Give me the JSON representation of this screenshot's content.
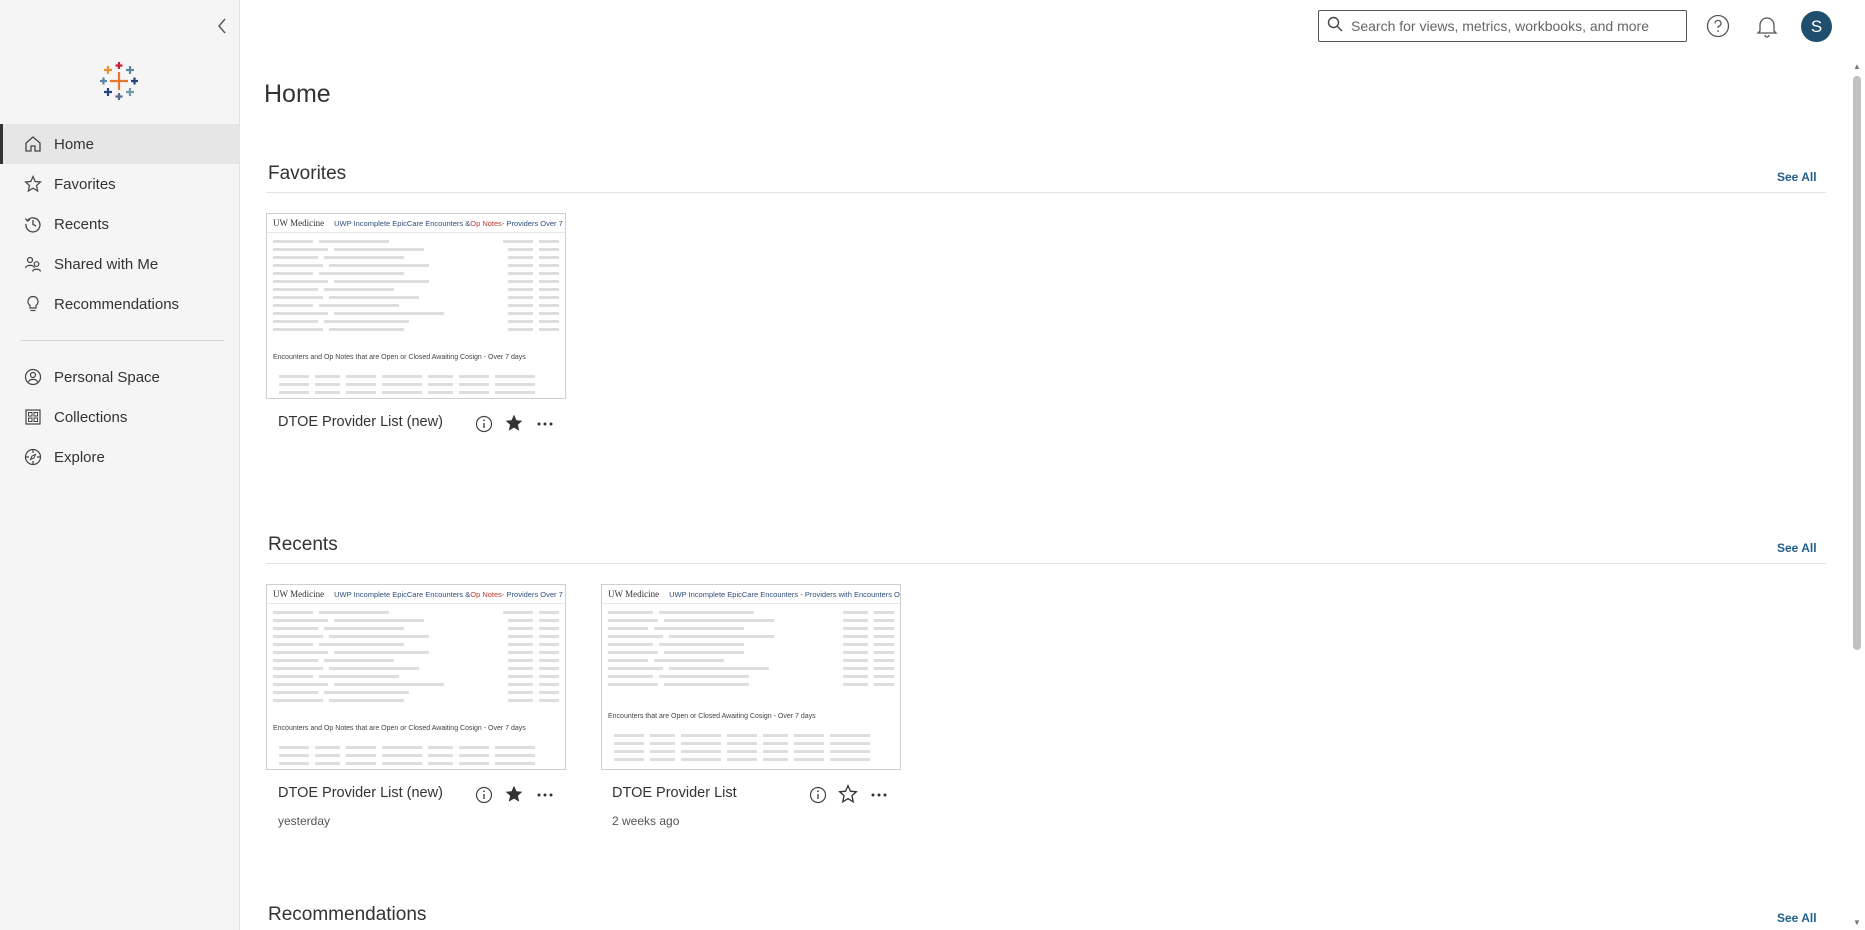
{
  "sidebar": {
    "collapse_icon": "chevron-left-icon",
    "items": [
      {
        "label": "Home",
        "icon": "home-icon"
      },
      {
        "label": "Favorites",
        "icon": "star-icon"
      },
      {
        "label": "Recents",
        "icon": "recents-icon"
      },
      {
        "label": "Shared with Me",
        "icon": "shared-icon"
      },
      {
        "label": "Recommendations",
        "icon": "lightbulb-icon"
      },
      {
        "label": "Personal Space",
        "icon": "person-icon"
      },
      {
        "label": "Collections",
        "icon": "collections-icon"
      },
      {
        "label": "Explore",
        "icon": "explore-icon"
      }
    ]
  },
  "topbar": {
    "search_placeholder": "Search for views, metrics, workbooks, and more",
    "avatar_initial": "S"
  },
  "main": {
    "title": "Home",
    "sections": {
      "favorites": {
        "title": "Favorites",
        "see_all": "See All"
      },
      "recents": {
        "title": "Recents",
        "see_all": "See All"
      },
      "recommendations": {
        "title": "Recommendations",
        "see_all": "See All"
      }
    }
  },
  "thumbnails": {
    "brand": "UW Medicine",
    "title_a": "UWP Incomplete EpicCare Encounters & ",
    "title_a_red": "Op Notes",
    "title_a_rest": " - Providers Over 7",
    "title_b": "UWP Incomplete EpicCare Encounters - Providers with Encounters Ove",
    "footer_a": "Encounters and Op Notes that are Open or Closed Awaiting Cosign - Over 7 days",
    "footer_b": "Encounters that are Open or Closed Awaiting Cosign - Over 7 days"
  },
  "cards": {
    "fav1": {
      "title": "DTOE Provider List (new)",
      "favorited": true
    },
    "rec1": {
      "title": "DTOE Provider List (new)",
      "time": "yesterday",
      "favorited": true
    },
    "rec2": {
      "title": "DTOE Provider List",
      "time": "2 weeks ago",
      "favorited": false
    }
  },
  "colors": {
    "accent": "#1f5f8f",
    "avatar_bg": "#1f4e6e"
  }
}
